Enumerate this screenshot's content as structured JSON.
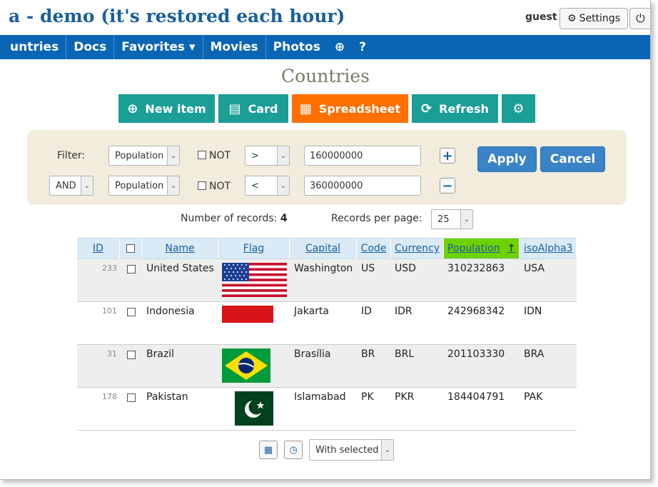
{
  "header": {
    "site_title": "a - demo (it's restored each hour)",
    "user": "guest",
    "settings_label": "Settings",
    "settings_icon": "gear-icon",
    "power_icon": "power-icon"
  },
  "nav": {
    "items": [
      {
        "label": "untries"
      },
      {
        "label": "Docs"
      },
      {
        "label": "Favorites ▾"
      },
      {
        "label": "Movies"
      },
      {
        "label": "Photos"
      },
      {
        "label": "⊕"
      },
      {
        "label": "?"
      }
    ]
  },
  "page": {
    "title": "Countries"
  },
  "toolbar": {
    "new_item": "New item",
    "card": "Card",
    "spreadsheet": "Spreadsheet",
    "refresh": "Refresh",
    "accent_teal": "#1a9e96",
    "accent_orange": "#ff7000"
  },
  "filter": {
    "label": "Filter:",
    "rows": [
      {
        "conjunction": "",
        "field": "Population",
        "not_label": "NOT",
        "operator": ">",
        "value": "160000000",
        "action": "+"
      },
      {
        "conjunction": "AND",
        "field": "Population",
        "not_label": "NOT",
        "operator": "<",
        "value": "360000000",
        "action": "−"
      }
    ],
    "apply": "Apply",
    "cancel": "Cancel"
  },
  "records": {
    "count_label": "Number of records:",
    "count": "4",
    "per_page_label": "Records per page:",
    "per_page": "25"
  },
  "table": {
    "columns": [
      "ID",
      "Name",
      "Flag",
      "Capital",
      "Code",
      "Currency",
      "Population",
      "isoAlpha3"
    ],
    "sort_indicator": "↑",
    "sorted_color": "#6ed100",
    "rows": [
      {
        "id": "233",
        "name": "United States",
        "flag": "usa",
        "capital": "Washington",
        "code": "US",
        "currency": "USD",
        "population": "310232863",
        "iso": "USA"
      },
      {
        "id": "101",
        "name": "Indonesia",
        "flag": "indonesia",
        "capital": "Jakarta",
        "code": "ID",
        "currency": "IDR",
        "population": "242968342",
        "iso": "IDN"
      },
      {
        "id": "31",
        "name": "Brazil",
        "flag": "brazil",
        "capital": "Brasília",
        "code": "BR",
        "currency": "BRL",
        "population": "201103330",
        "iso": "BRA"
      },
      {
        "id": "178",
        "name": "Pakistan",
        "flag": "pakistan",
        "capital": "Islamabad",
        "code": "PK",
        "currency": "PKR",
        "population": "184404791",
        "iso": "PAK"
      }
    ]
  },
  "footer": {
    "calculator_icon": "calculator-icon",
    "clock_icon": "clock-icon",
    "with_selected": "With selected"
  }
}
